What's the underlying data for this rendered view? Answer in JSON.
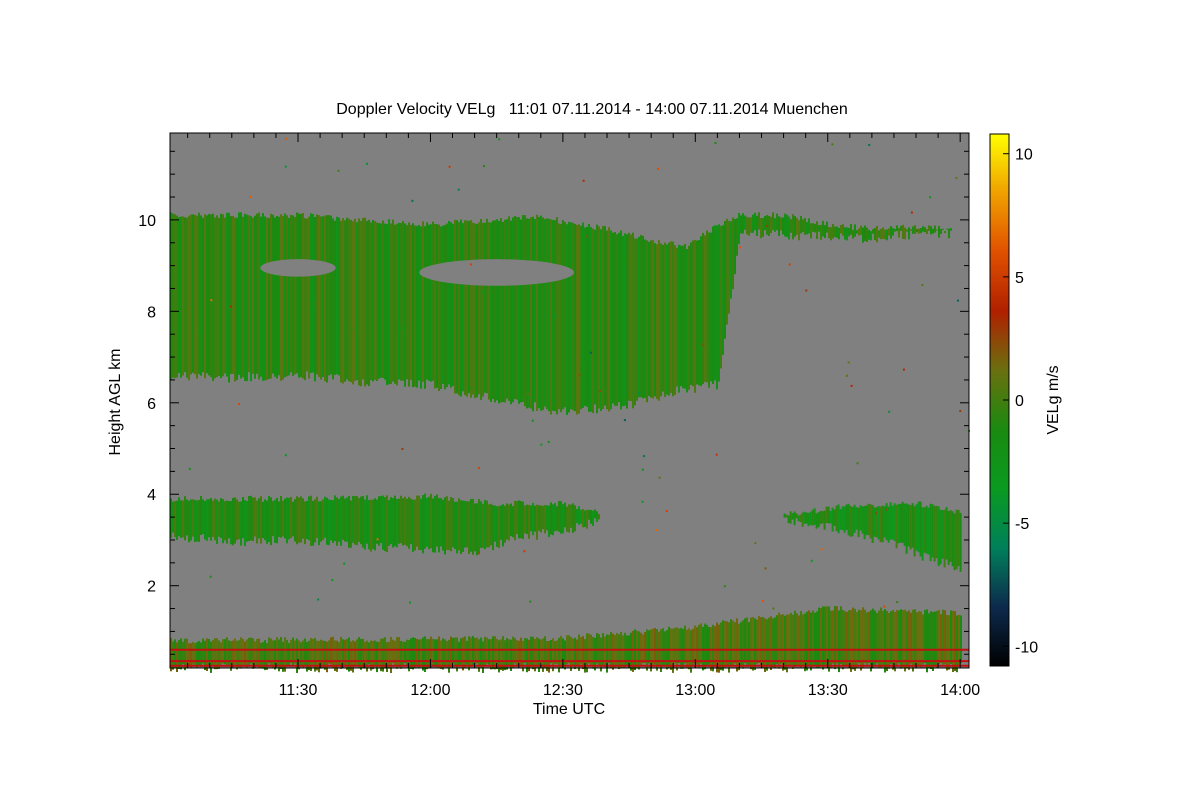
{
  "chart_data": {
    "type": "heatmap",
    "title": "Doppler Velocity VELg   11:01 07.11.2014 - 14:00 07.11.2014 Muenchen",
    "xlabel": "Time UTC",
    "ylabel": "Height AGL km",
    "xlim": [
      "11:01",
      "14:02"
    ],
    "ylim": [
      0.2,
      11.9
    ],
    "x_ticks": [
      "11:30",
      "12:00",
      "12:30",
      "13:00",
      "13:30",
      "14:00"
    ],
    "y_ticks": [
      2,
      4,
      6,
      8,
      10
    ],
    "colorbar": {
      "label": "VELg m/s",
      "range": [
        -10.8,
        10.8
      ],
      "ticks": [
        10,
        5,
        0,
        -5,
        -10
      ],
      "colors": [
        "#000000",
        "#0d2a4d",
        "#00805a",
        "#0a9a20",
        "#1a8a10",
        "#6a7010",
        "#b02000",
        "#e05000",
        "#f0a000",
        "#ffff00"
      ]
    },
    "background_color": "#808080",
    "layers": [
      {
        "name": "upper-cloud",
        "mean_velocity": -0.8,
        "top": [
          [
            "11:01",
            10.1
          ],
          [
            "11:30",
            10.1
          ],
          [
            "11:45",
            10.0
          ],
          [
            "12:00",
            9.9
          ],
          [
            "12:15",
            10.0
          ],
          [
            "12:25",
            10.1
          ],
          [
            "12:30",
            9.95
          ],
          [
            "12:40",
            9.8
          ],
          [
            "12:50",
            9.55
          ],
          [
            "12:58",
            9.4
          ],
          [
            "13:05",
            9.9
          ],
          [
            "13:10",
            10.1
          ],
          [
            "13:20",
            10.1
          ],
          [
            "13:30",
            9.9
          ],
          [
            "13:40",
            9.8
          ],
          [
            "13:50",
            9.85
          ],
          [
            "13:58",
            9.8
          ]
        ],
        "bottom": [
          [
            "11:01",
            6.6
          ],
          [
            "11:15",
            6.55
          ],
          [
            "11:30",
            6.6
          ],
          [
            "11:45",
            6.45
          ],
          [
            "12:00",
            6.4
          ],
          [
            "12:15",
            6.05
          ],
          [
            "12:30",
            5.8
          ],
          [
            "12:45",
            5.95
          ],
          [
            "12:55",
            6.25
          ],
          [
            "13:05",
            6.4
          ],
          [
            "13:10",
            9.7
          ],
          [
            "13:25",
            9.65
          ],
          [
            "13:40",
            9.6
          ],
          [
            "13:50",
            9.7
          ],
          [
            "13:58",
            9.7
          ]
        ]
      },
      {
        "name": "mid-cloud-west",
        "mean_velocity": -1.2,
        "top": [
          [
            "11:01",
            3.9
          ],
          [
            "11:30",
            3.9
          ],
          [
            "12:00",
            3.95
          ],
          [
            "12:15",
            3.8
          ],
          [
            "12:30",
            3.8
          ],
          [
            "12:38",
            3.6
          ]
        ],
        "bottom": [
          [
            "11:01",
            3.1
          ],
          [
            "11:15",
            2.95
          ],
          [
            "11:30",
            3.0
          ],
          [
            "11:45",
            2.85
          ],
          [
            "12:00",
            2.8
          ],
          [
            "12:10",
            2.75
          ],
          [
            "12:20",
            3.05
          ],
          [
            "12:30",
            3.2
          ],
          [
            "12:38",
            3.4
          ]
        ]
      },
      {
        "name": "mid-cloud-east",
        "mean_velocity": -1.5,
        "top": [
          [
            "13:20",
            3.55
          ],
          [
            "13:35",
            3.75
          ],
          [
            "13:50",
            3.8
          ],
          [
            "14:00",
            3.6
          ]
        ],
        "bottom": [
          [
            "13:20",
            3.45
          ],
          [
            "13:30",
            3.3
          ],
          [
            "13:45",
            2.9
          ],
          [
            "13:55",
            2.5
          ],
          [
            "14:00",
            2.4
          ]
        ]
      },
      {
        "name": "boundary-layer",
        "mean_velocity": 0.2,
        "top": [
          [
            "11:01",
            0.8
          ],
          [
            "12:30",
            0.85
          ],
          [
            "13:00",
            1.1
          ],
          [
            "13:30",
            1.5
          ],
          [
            "14:00",
            1.4
          ]
        ],
        "bottom": [
          [
            "11:01",
            0.2
          ],
          [
            "14:00",
            0.2
          ]
        ]
      }
    ],
    "clear_gaps": [
      {
        "center": [
          "11:30",
          8.95
        ],
        "width_min": 8,
        "height_km": 0.25
      },
      {
        "center": [
          "12:15",
          8.85
        ],
        "width_min": 26,
        "height_km": 0.45
      }
    ],
    "artifact_lines_km": [
      0.6,
      0.35,
      0.25
    ]
  }
}
